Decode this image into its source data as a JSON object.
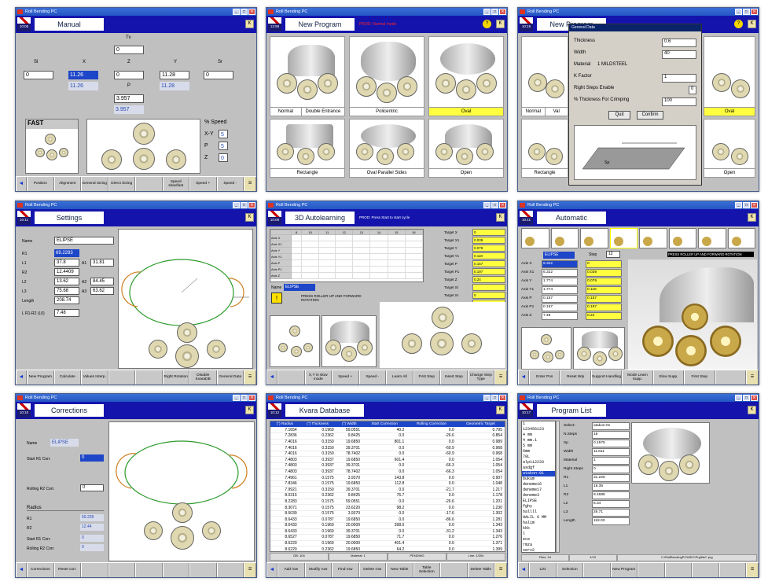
{
  "win_title": "Roll Bending PC",
  "tb_buttons": [
    "_",
    "□",
    "✕"
  ],
  "clock": [
    "10:06",
    "12:59",
    "10:15",
    "10:11",
    "10:09",
    "10:11",
    "10:10",
    "10:12",
    "10:17"
  ],
  "manual": {
    "title": "Manual",
    "tv": "Tv",
    "tv_val": "0",
    "sl": "Sl",
    "x": "X",
    "z": "Z",
    "y": "Y",
    "sr": "Sr",
    "sl_val": "0",
    "x_val": "11.26",
    "x_ro": "11.26",
    "z_val": "0",
    "y_val": "11.28",
    "y_ro": "11.28",
    "sr_val": "0",
    "p": "P",
    "p_val": "3.957",
    "p_ro": "3.957",
    "fast": "FAST",
    "speed": "% Speed",
    "xy": "X-Y",
    "xy_val": "5",
    "pl": "P",
    "p_speed": "5",
    "zl": "Z",
    "z_speed": "0",
    "buttons": [
      "Position",
      "Alignment",
      "General Sizing",
      "Direct Sizing",
      "",
      "Speed slow/fast",
      "Speed +",
      "Speed -"
    ]
  },
  "newprog": {
    "title": "New Program",
    "note": "PROD: Normal mode",
    "cells": [
      "Normal",
      "Double Entrance",
      "Policentric",
      "Oval",
      "Rectangle",
      "Oval Parallel Sides",
      "Open"
    ]
  },
  "general": {
    "title": "New Program",
    "dlg": "General Data",
    "rows": [
      [
        "Thickness",
        "0.6"
      ],
      [
        "Width",
        "40"
      ],
      [
        "Material",
        "1  MILDSTEEL"
      ],
      [
        "K Factor",
        "1"
      ],
      [
        "Right Steps Enable",
        "0"
      ],
      [
        "% Thickness For Crimping",
        "100"
      ]
    ],
    "quit": "Quit",
    "confirm": "Confirm",
    "cap1": "Normal",
    "cap2": "Val",
    "cap3": "Oval",
    "cap4": "Rectangle",
    "cap5": "Open",
    "sp": "Sp."
  },
  "settings": {
    "title": "Settings",
    "name_l": "Name",
    "name": "ELIPSE",
    "r1": "R1",
    "r1v": "69.2283",
    "l1": "L1",
    "l1v": "37.8",
    "a1": "A1",
    "a1v": "31.81",
    "r2": "R2",
    "r2v": "12.4409",
    "l2": "L2",
    "l2v": "13.62",
    "a2": "A2",
    "a2v": "84.45",
    "l3": "L3",
    "l3v": "75.68",
    "a3": "A3",
    "a3v": "63.62",
    "len": "Length",
    "lenv": "208.74",
    "lrl": "L R1-R2 (L0)",
    "lrlv": "7.48",
    "buttons": [
      "New Program",
      "Calculate",
      "Values Interp.",
      "",
      "",
      "Right Rotation",
      "Disable KvaraDB",
      "General Data"
    ]
  },
  "auto3d": {
    "title": "3D Autolearning",
    "note": "PROD: Press Start to start cycle",
    "targets": [
      [
        "Target X",
        "0"
      ],
      [
        "Target X1",
        "0.039"
      ],
      [
        "Target Y",
        "0.079"
      ],
      [
        "Target Y1",
        "0.118"
      ],
      [
        "Target P",
        "0.157"
      ],
      [
        "Target P1",
        "0.197"
      ],
      [
        "Target Z",
        "0.24"
      ],
      [
        "Target Sl",
        ""
      ],
      [
        "Target Sr",
        "0"
      ],
      [
        "Target Tv",
        "0"
      ]
    ],
    "name_l": "Name",
    "name": "ELIPSE",
    "msg": "PRESS ROLLER UP AND FORWARD ROTATION",
    "cols": [
      "8",
      "10",
      "11",
      "12",
      "13",
      "14",
      "15",
      "16"
    ],
    "rows": [
      "Axis X",
      "Axis X1",
      "Axis Y",
      "Axis Y1",
      "Axis P",
      "Axis P1",
      "Axis Z"
    ],
    "buttons": [
      "X,Y in slow mode",
      "Speed +",
      "Speed -",
      "Learn All",
      "First Step",
      "Insert Step",
      "Change Step Type"
    ]
  },
  "automatic": {
    "title": "Automatic",
    "name": "ELIPSE",
    "steps_l": "Step",
    "steps": "12",
    "axes": [
      [
        "Axis X",
        "6.322",
        "0"
      ],
      [
        "Axis X1",
        "6.322",
        "0.039"
      ],
      [
        "Axis Y",
        "1.774",
        "0.079"
      ],
      [
        "Axis Y1",
        "1.774",
        "0.118"
      ],
      [
        "Axis P",
        "0.157",
        "0.157"
      ],
      [
        "Axis P1",
        "0.157",
        "0.197"
      ],
      [
        "Axis Z",
        "7.46",
        "0.24"
      ]
    ],
    "msg": "PRESS ROLLER UP AND FORWARD ROTATION",
    "buttons": [
      "Enter Pos",
      "Reset Wip",
      "Support Handling",
      "Mode Learn Supp.",
      "Slow Supp.",
      "First Step"
    ]
  },
  "corrections": {
    "title": "Corrections",
    "name_l": "Name",
    "name": "ELIPSE",
    "sr1": "Start R1 Corr.",
    "sr1v": "0",
    "rr2": "Rolling R2 Corr.",
    "rr2v": "0",
    "radius": "Radius",
    "r1": "R1",
    "r1v": "69.228",
    "r2": "R2",
    "r2v": "12.44",
    "sr1b": "Start R1 Corr.",
    "sr1bv": "0",
    "rr2b": "Rolling R2 Corr.",
    "rr2bv": "0",
    "buttons": [
      "Corrections",
      "Reset corr.",
      "",
      "",
      "",
      "",
      "",
      ""
    ]
  },
  "kvara": {
    "title": "Kvara Database",
    "cols": [
      "(\") Radius",
      "(\") Thickness",
      "(\") Width",
      "Start Correction",
      "Rolling Correction",
      "Geometric Target"
    ],
    "rows": [
      [
        "7.1654",
        "0.1969",
        "59.0551",
        "40.2",
        "0.0",
        "0.795"
      ],
      [
        "7.2836",
        "0.2362",
        "9.8425",
        "0.0",
        "-26.6",
        "0.854"
      ],
      [
        "7.4016",
        "0.3150",
        "19.6850",
        "801.1",
        "0.0",
        "0.989"
      ],
      [
        "7.4016",
        "0.3150",
        "39.3701",
        "0.0",
        "-60.9",
        "0.968"
      ],
      [
        "7.4016",
        "0.3150",
        "78.7402",
        "0.0",
        "-60.9",
        "0.968"
      ],
      [
        "7.4803",
        "0.3937",
        "19.6850",
        "601.4",
        "0.0",
        "1.054"
      ],
      [
        "7.4803",
        "0.3937",
        "39.3701",
        "0.0",
        "-66.3",
        "1.054"
      ],
      [
        "7.4803",
        "0.3937",
        "78.7402",
        "0.0",
        "-66.3",
        "1.054"
      ],
      [
        "7.4961",
        "0.1575",
        "3.9370",
        "143.8",
        "0.0",
        "0.907"
      ],
      [
        "7.8346",
        "0.1575",
        "19.6850",
        "112.8",
        "0.0",
        "1.048"
      ],
      [
        "7.9921",
        "0.3150",
        "39.3701",
        "0.0",
        "-21.7",
        "1.217"
      ],
      [
        "8.0315",
        "0.2362",
        "9.8425",
        "76.7",
        "0.0",
        "1.178"
      ],
      [
        "8.2283",
        "0.1575",
        "59.0551",
        "0.0",
        "-26.6",
        "1.201"
      ],
      [
        "8.3071",
        "0.1575",
        "23.6220",
        "98.2",
        "0.0",
        "1.230"
      ],
      [
        "8.5039",
        "0.1575",
        "3.9370",
        "0.0",
        "-17.6",
        "1.302"
      ],
      [
        "8.6433",
        "0.0787",
        "19.6850",
        "0.0",
        "-86.6",
        "1.281"
      ],
      [
        "8.6433",
        "0.1969",
        "20.0000",
        "398.0",
        "0.0",
        "1.343"
      ],
      [
        "8.6433",
        "0.1969",
        "39.3701",
        "0.0",
        "-31.2",
        "1.343"
      ],
      [
        "8.6527",
        "0.0787",
        "19.6850",
        "71.7",
        "0.0",
        "1.276"
      ],
      [
        "8.6220",
        "0.1969",
        "20.0000",
        "401.4",
        "0.0",
        "1.371"
      ],
      [
        "8.6220",
        "0.2362",
        "19.6850",
        "64.2",
        "0.0",
        "1.399"
      ]
    ],
    "status": [
      "DB: 104",
      "Material: 1",
      "PENDING",
      "Line: 1/204"
    ],
    "buttons": [
      "Add row",
      "Modify row",
      "Find row",
      "Delete row",
      "New Table",
      "Table Selection",
      "",
      "Delete Table"
    ]
  },
  "proglist": {
    "title": "Program List",
    "list": [
      "1",
      "123456123",
      "4 mm",
      "4 mm.1",
      "5 mm",
      "6mm",
      "78L",
      "alp112233",
      "asdgf",
      "atakon-01",
      "bukum",
      "deneme16",
      "deneme17",
      "deneme3",
      "ELIPSE",
      "fghy",
      "hallll",
      "HALIL 6 MM",
      "halim",
      "kkk",
      "l",
      "ece",
      "rmza",
      "serv2"
    ],
    "fields": [
      [
        "Select:",
        "atakon-01"
      ],
      [
        "N.Steps",
        "16"
      ],
      [
        "Sp",
        "0.1575"
      ],
      [
        "Width",
        "11.811"
      ],
      [
        "Material",
        "1"
      ],
      [
        "Right Steps",
        "0"
      ],
      [
        "R1",
        "31.225"
      ],
      [
        "L1",
        "18.35"
      ],
      [
        "R2",
        "8.4685"
      ],
      [
        "L2",
        "6.34"
      ],
      [
        "L3",
        "26.71"
      ],
      [
        "Length",
        "118.03"
      ]
    ],
    "status": [
      "Files: 24",
      "1/10",
      "C:\\RollBendingPC\\MDC\\Prg\\file\\*.prg"
    ],
    "buttons": [
      "List",
      "Selection",
      "",
      "New Program",
      "",
      "",
      "",
      ""
    ]
  }
}
